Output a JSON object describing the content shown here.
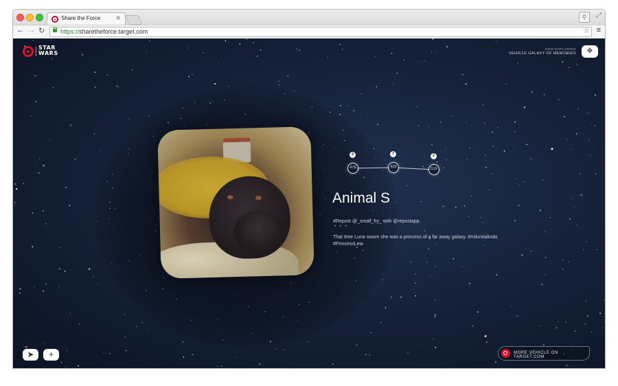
{
  "browser": {
    "tab_title": "Share the Force",
    "url_scheme": "https://",
    "url_host": "sharetheforce.target.com"
  },
  "header": {
    "logo_star": "STAR",
    "logo_wars": "WARS",
    "exploring_label": "NOW EXPLORING",
    "exploring_value": "VEHICLE GALAXY OF MEMORIES"
  },
  "timeline": {
    "nodes": [
      {
        "count": "476",
        "badge": "4"
      },
      {
        "count": "429",
        "badge": "7"
      },
      {
        "count": "519",
        "badge": "2"
      }
    ]
  },
  "post": {
    "title": "Animal S",
    "repost": "#Repost @_small_fry_ with @repostapp.",
    "separator": "• • •",
    "caption": "That time Luna swore she was a princess of a far away galaxy. #milunitalinda #PrincessLeia"
  },
  "footer": {
    "cta_label": "MORE VEHICLE ON TARGET.COM"
  },
  "colors": {
    "accent": "#e0102b",
    "space": "#16223a"
  },
  "icons": {
    "locate": "navigate-arrow-icon",
    "add": "plus-icon",
    "explore": "move-icon"
  }
}
